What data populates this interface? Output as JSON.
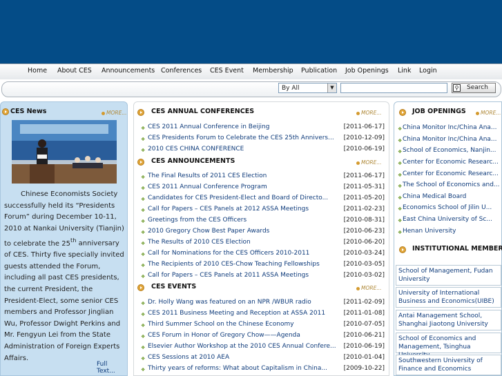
{
  "nav": [
    "Home",
    "About CES",
    "Announcements",
    "Conferences",
    "CES Event",
    "Membership",
    "Publication",
    "Job Openings",
    "Link",
    "Login"
  ],
  "search": {
    "scope": "By All",
    "button": "Search"
  },
  "news": {
    "title": "CES News",
    "more": "MORE",
    "body_before": "Chinese Economists Society successfully held its “Presidents Forum” during December 10-11, 2010 at Nankai University (Tianjin) to celebrate the 25",
    "sup": "th",
    "body_after": " anniversary of CES. Thirty five specially invited guests attended the Forum, including all past CES presidents, the current President, the President-Elect, some senior CES members and Professor Jinglian Wu, Professor Dwight Perkins and Mr. Fengyun Lei from the State Administration of Foreign Experts Affairs.",
    "full": "Full Text..."
  },
  "conferences": {
    "title": "CES ANNUAL CONFERENCES",
    "more": "MORE",
    "items": [
      {
        "title": "CES 2011 Annual Conference in Beijing",
        "date": "[2011-06-17]"
      },
      {
        "title": "CES Presidents Forum to Celebrate the CES 25th Annivers...",
        "date": "[2010-12-09]"
      },
      {
        "title": "2010 CES CHINA CONFERENCE",
        "date": "[2010-06-19]"
      }
    ]
  },
  "announcements": {
    "title": "CES ANNOUNCEMENTS",
    "more": "MORE",
    "items": [
      {
        "title": "The Final Results of 2011 CES Election",
        "date": "[2011-06-17]"
      },
      {
        "title": "CES 2011 Annual Conference Program",
        "date": "[2011-05-31]"
      },
      {
        "title": "Candidates for CES President-Elect and Board of Directo...",
        "date": "[2011-05-20]"
      },
      {
        "title": "Call for Papers – CES Panels at 2012 ASSA Meetings",
        "date": "[2011-02-23]"
      },
      {
        "title": "Greetings from the CES Officers",
        "date": "[2010-08-31]"
      },
      {
        "title": "2010 Gregory Chow Best Paper Awards",
        "date": "[2010-06-23]"
      },
      {
        "title": "The Results of 2010 CES Election",
        "date": "[2010-06-20]"
      },
      {
        "title": "Call for Nominations for the CES Officers 2010-2011",
        "date": "[2010-03-24]"
      },
      {
        "title": "The Recipients of 2010 CES-Chow Teaching Fellowships",
        "date": "[2010-03-05]"
      },
      {
        "title": "Call for Papers – CES Panels at 2011 ASSA Meetings",
        "date": "[2010-03-02]"
      }
    ]
  },
  "events": {
    "title": "CES EVENTS",
    "more": "MORE",
    "items": [
      {
        "title": "Dr. Holly Wang was featured on an NPR /WBUR radio",
        "date": "[2011-02-09]"
      },
      {
        "title": "CES 2011 Business Meeting and Reception at ASSA 2011",
        "date": "[2011-01-08]"
      },
      {
        "title": "Third Summer School on the Chinese Economy",
        "date": "[2010-07-05]"
      },
      {
        "title": "CES Forum in Honor of Gregory Chow——Agenda",
        "date": "[2010-06-21]"
      },
      {
        "title": "Elsevier Author Workshop at the 2010 CES Annual Confere...",
        "date": "[2010-06-19]"
      },
      {
        "title": "CES Sessions at 2010 AEA",
        "date": "[2010-01-04]"
      },
      {
        "title": "Thirty years of reforms: What about Capitalism in China...",
        "date": "[2009-10-22]"
      }
    ]
  },
  "jobs": {
    "title": "JOB OPENINGS",
    "more": "MORE",
    "items": [
      "China Monitor Inc/China Ana...",
      "China Monitor Inc/China Ana...",
      "School of Economics, Nanjin...",
      "Center for Economic Researc...",
      "Center for Economic Researc...",
      "The School of Economics and...",
      "China Medical Board",
      "Economics School of Jilin U...",
      "East China University of Sc...",
      "Henan University"
    ]
  },
  "institutions": {
    "title": "INSTITUTIONAL MEMBERS",
    "items": [
      "School of Management, Fudan University",
      "University of International Business and Economics(UIBE)",
      "Antai Management School, Shanghai Jiaotong University",
      "School of Economics and Management, Tsinghua University",
      "Southwestern University of Finance and Economics"
    ]
  },
  "colors": {
    "banner": "#044c87",
    "accent": "#e1a63a",
    "link": "#0d3a7a",
    "news_bg": "#c7dff1"
  }
}
